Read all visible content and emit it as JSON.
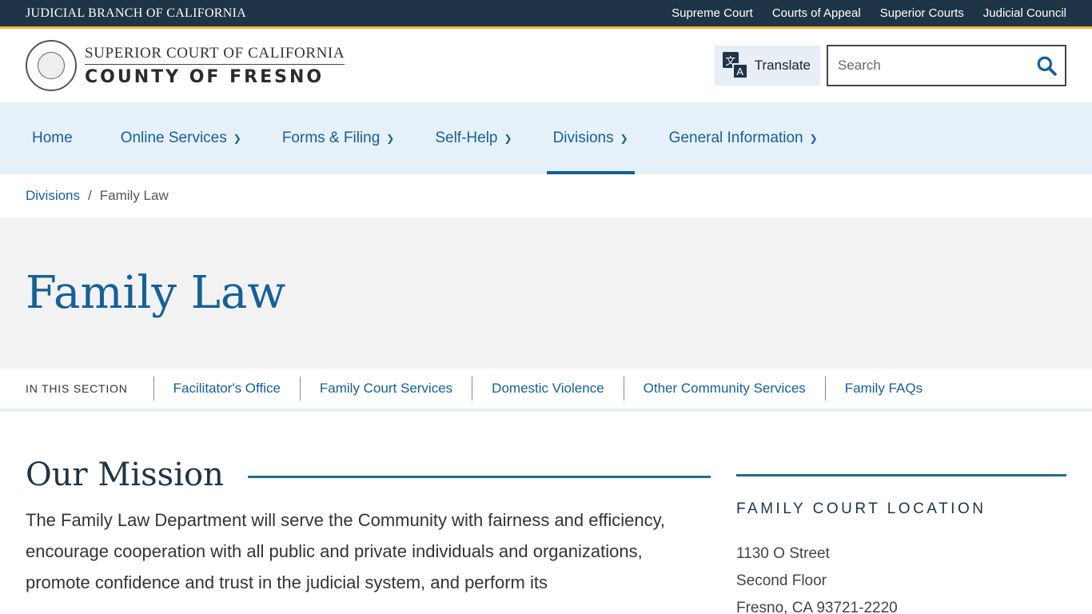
{
  "topbar": {
    "brand": "JUDICIAL BRANCH OF CALIFORNIA",
    "links": [
      "Supreme Court",
      "Courts of Appeal",
      "Superior Courts",
      "Judicial Council"
    ]
  },
  "header": {
    "logo_line1": "SUPERIOR COURT OF CALIFORNIA",
    "logo_line2": "COUNTY OF FRESNO",
    "translate_label": "Translate",
    "search_placeholder": "Search"
  },
  "nav": {
    "items": [
      {
        "label": "Home"
      },
      {
        "label": "Online Services"
      },
      {
        "label": "Forms & Filing"
      },
      {
        "label": "Self-Help"
      },
      {
        "label": "Divisions"
      },
      {
        "label": "General Information"
      }
    ]
  },
  "breadcrumb": {
    "parent": "Divisions",
    "separator": "/",
    "current": "Family Law"
  },
  "hero": {
    "title": "Family Law"
  },
  "section_nav": {
    "label": "IN THIS SECTION",
    "links": [
      "Facilitator's Office",
      "Family Court Services",
      "Domestic Violence",
      "Other Community Services",
      "Family FAQs"
    ]
  },
  "main": {
    "heading": "Our Mission",
    "text": "The Family Law Department will serve the Community with fairness and efficiency, encourage cooperation with all public and private individuals and organizations, promote confidence and trust in the judicial system, and perform its"
  },
  "aside": {
    "heading": "FAMILY COURT LOCATION",
    "address": [
      "1130 O Street",
      "Second Floor",
      "Fresno, CA 93721-2220"
    ]
  },
  "colors": {
    "topbar_bg": "#1f3446",
    "accent_gold": "#f0b63c",
    "link_blue": "#156097",
    "nav_bg": "#e6f0f8",
    "rule_teal": "#226c86"
  }
}
